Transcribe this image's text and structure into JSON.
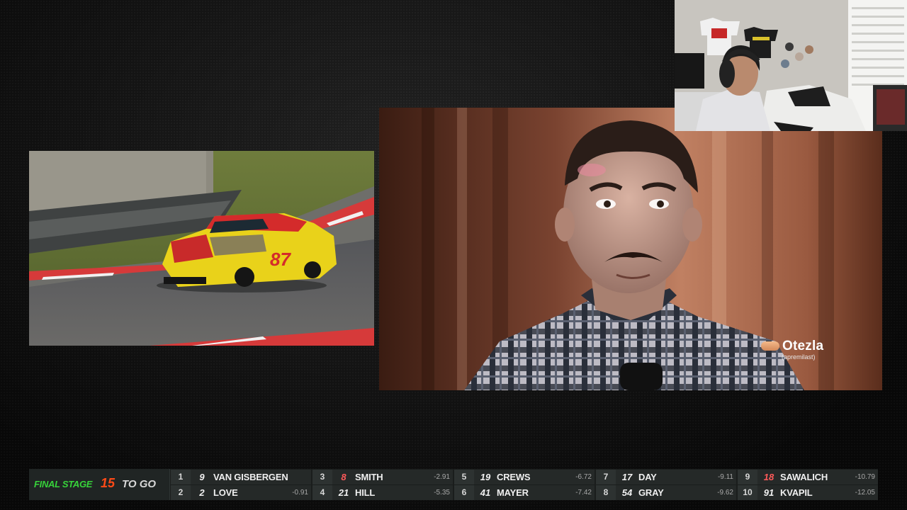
{
  "stream": {
    "ad": {
      "brand": "Otezla",
      "brand_sub": "(apremilast)"
    },
    "race_car": {
      "number": "87"
    }
  },
  "ticker": {
    "stage_label": "FINAL STAGE",
    "laps_to_go": "15",
    "to_go_label": "TO GO",
    "standings": [
      {
        "pos": "1",
        "car": "9",
        "name": "VAN GISBERGEN",
        "gap": ""
      },
      {
        "pos": "2",
        "car": "2",
        "name": "LOVE",
        "gap": "-0.91"
      },
      {
        "pos": "3",
        "car": "8",
        "name": "SMITH",
        "gap": "-2.91"
      },
      {
        "pos": "4",
        "car": "21",
        "name": "HILL",
        "gap": "-5.35"
      },
      {
        "pos": "5",
        "car": "19",
        "name": "CREWS",
        "gap": "-6.72"
      },
      {
        "pos": "6",
        "car": "41",
        "name": "MAYER",
        "gap": "-7.42"
      },
      {
        "pos": "7",
        "car": "17",
        "name": "DAY",
        "gap": "-9.11"
      },
      {
        "pos": "8",
        "car": "54",
        "name": "GRAY",
        "gap": "-9.62"
      },
      {
        "pos": "9",
        "car": "18",
        "name": "SAWALICH",
        "gap": "-10.79"
      },
      {
        "pos": "10",
        "car": "91",
        "name": "KVAPIL",
        "gap": "-12.05"
      }
    ]
  },
  "colors": {
    "stage_green": "#37d33a",
    "laps_orange": "#ff4a17",
    "car_number_red": "#ff5a5a"
  }
}
